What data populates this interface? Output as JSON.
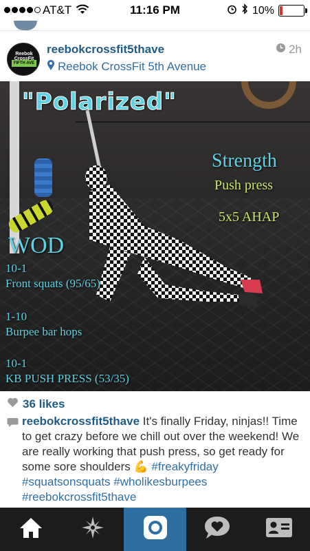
{
  "status_bar": {
    "carrier": "AT&T",
    "time": "11:16 PM",
    "battery": "10%",
    "signal_bars": 4
  },
  "post": {
    "username": "reebokcrossfit5thave",
    "location": "Reebok CrossFit 5th Avenue",
    "time_ago": "2h",
    "avatar_logo_top": "Reebok CrossFit",
    "avatar_logo_bottom": "FIFTH AVE",
    "image_text": {
      "title": "\"Polarized\"",
      "strength_label": "Strength",
      "strength_movement": "Push press",
      "strength_scheme": "5x5 AHAP",
      "wod_label": "WOD",
      "wod_lines": [
        "10-1",
        "Front squats (95/65)",
        "1-10",
        "Burpee bar hops",
        "10-1",
        "KB PUSH PRESS (53/35)"
      ]
    },
    "likes": "36 likes",
    "caption_user": "reebokcrossfit5thave",
    "caption_text": " It's finally Friday, ninjas!! Time to get crazy before we chill out over the weekend! We are really working that push press, so get ready for some sore shoulders 💪 ",
    "hashtags": [
      "#freakyfriday",
      "#squatsonsquats",
      "#wholikesburpees",
      "#reebokcrossfit5thave"
    ]
  },
  "tabs": [
    {
      "name": "home",
      "icon": "home-icon"
    },
    {
      "name": "explore",
      "icon": "compass-star-icon"
    },
    {
      "name": "camera",
      "icon": "camera-icon",
      "active": true
    },
    {
      "name": "news",
      "icon": "speech-heart-icon"
    },
    {
      "name": "profile",
      "icon": "profile-card-icon"
    }
  ],
  "colors": {
    "link_blue": "#1f5b87",
    "overlay_cyan": "#5fd3e6",
    "overlay_green": "#c7e86a",
    "tabbar_bg": "#1c1c1c",
    "tab_active": "#2f6ea1"
  }
}
